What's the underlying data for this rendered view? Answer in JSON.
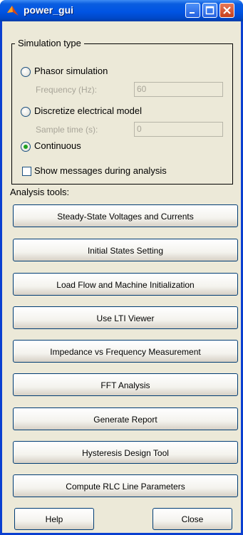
{
  "window": {
    "title": "power_gui"
  },
  "simulation_type": {
    "legend": "Simulation type",
    "phasor": {
      "label": "Phasor simulation",
      "selected": false
    },
    "frequency": {
      "label": "Frequency (Hz):",
      "value": "60"
    },
    "discretize": {
      "label": "Discretize electrical  model",
      "selected": false
    },
    "sample_time": {
      "label": "Sample time (s):",
      "value": "0"
    },
    "continuous": {
      "label": "Continuous",
      "selected": true
    },
    "show_messages": {
      "label": "Show messages during analysis",
      "checked": false
    }
  },
  "analysis_tools": {
    "label": "Analysis tools:",
    "buttons": [
      "Steady-State Voltages and Currents",
      "Initial States Setting",
      "Load Flow and Machine Initialization",
      "Use LTI Viewer",
      "Impedance vs Frequency Measurement",
      "FFT Analysis",
      "Generate Report",
      "Hysteresis Design Tool",
      "Compute RLC  Line Parameters"
    ]
  },
  "footer": {
    "help_label": "Help",
    "close_label": "Close"
  },
  "colors": {
    "titlebar": "#0054e3",
    "window_bg": "#ece9d8",
    "radio_selected": "#21a121",
    "close_button": "#c33f1d"
  }
}
